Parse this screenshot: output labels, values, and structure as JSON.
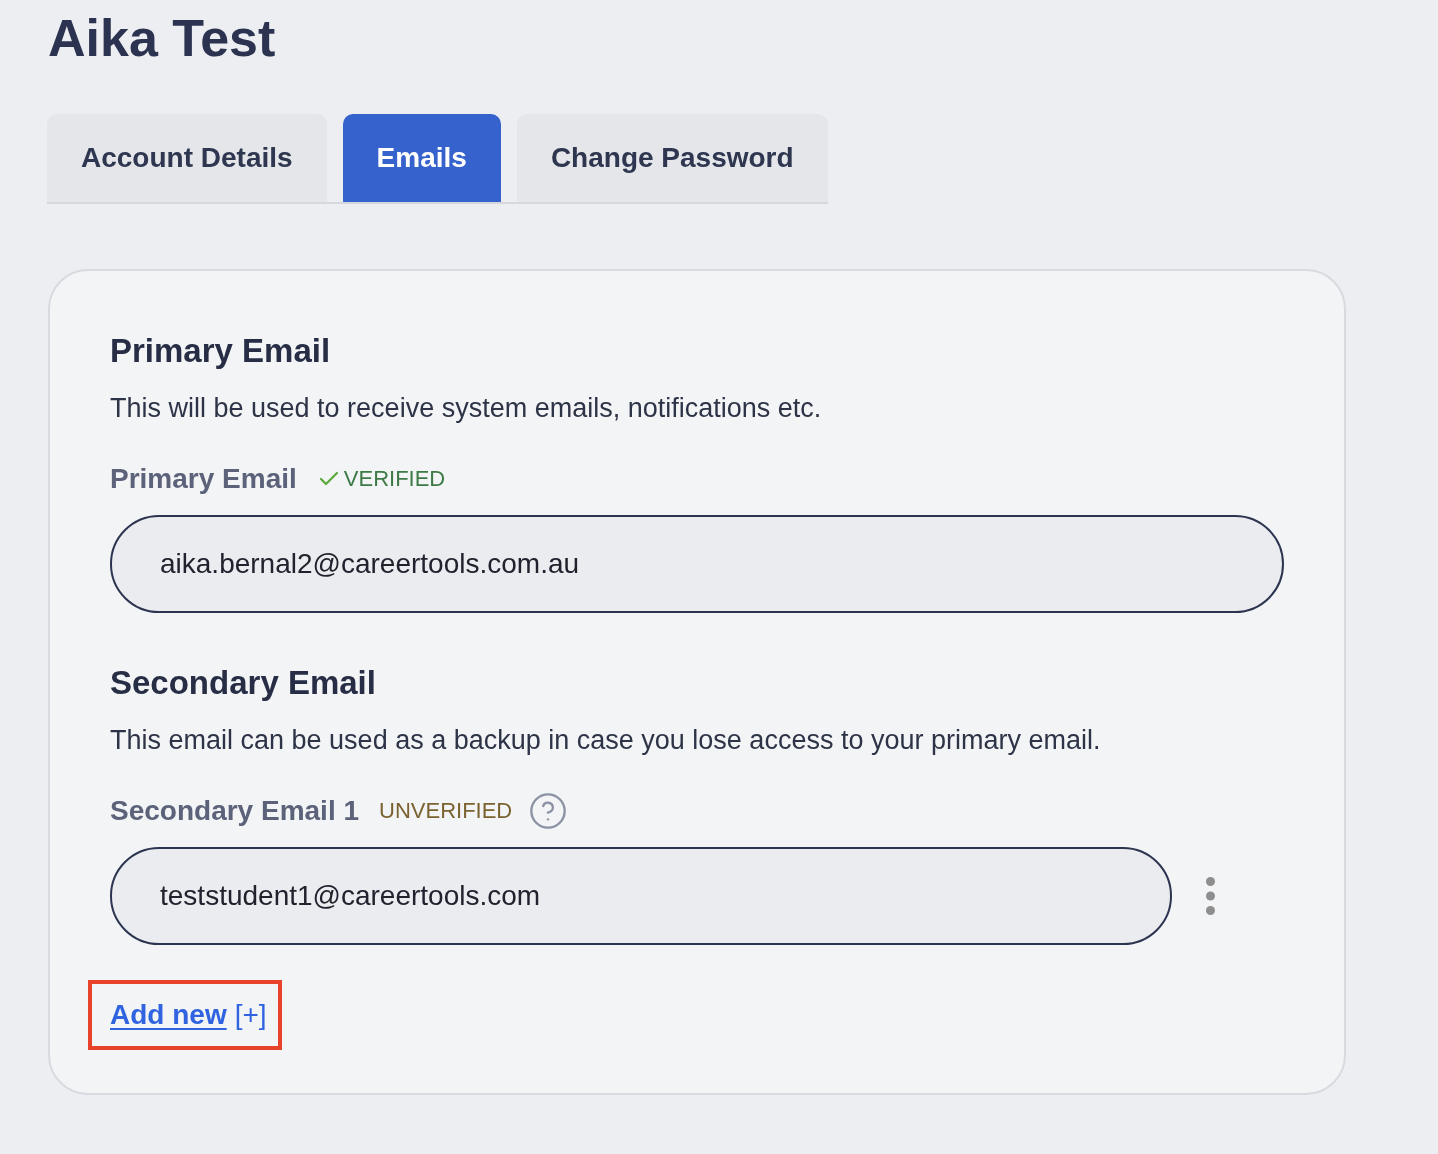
{
  "page": {
    "title": "Aika Test"
  },
  "tabs": [
    {
      "label": "Account Details",
      "selected": false
    },
    {
      "label": "Emails",
      "selected": true
    },
    {
      "label": "Change Password",
      "selected": false
    }
  ],
  "sections": [
    {
      "heading": "Primary Email",
      "description": "This will be used to receive system emails, notifications etc.",
      "fields": [
        {
          "label": "Primary Email",
          "status": "VERIFIED",
          "verified": true,
          "value": "aika.bernal2@careertools.com.au"
        }
      ]
    },
    {
      "heading": "Secondary Email",
      "description": "This email can be used as a backup in case you lose access to your primary email.",
      "fields": [
        {
          "label": "Secondary Email 1",
          "status": "UNVERIFIED",
          "verified": false,
          "value": "teststudent1@careertools.com",
          "has_menu": true
        }
      ]
    }
  ],
  "add_new": {
    "link": "Add new",
    "suffix": "[+]",
    "highlighted": true
  }
}
